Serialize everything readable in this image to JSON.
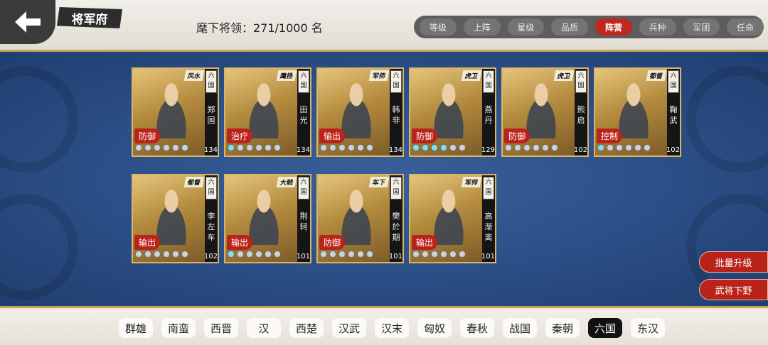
{
  "header": {
    "title": "将军府",
    "troop_count": "麾下将领：271/1000 名"
  },
  "sort_tabs": [
    {
      "label": "等级",
      "active": false
    },
    {
      "label": "上阵",
      "active": false
    },
    {
      "label": "星级",
      "active": false
    },
    {
      "label": "品质",
      "active": false
    },
    {
      "label": "阵营",
      "active": true
    },
    {
      "label": "兵种",
      "active": false
    },
    {
      "label": "军团",
      "active": false
    },
    {
      "label": "任命",
      "active": false
    }
  ],
  "generals": [
    {
      "name": "郑国",
      "title": "风水",
      "nation": "六国",
      "role": "防御",
      "level": "134",
      "stars_lit": 0
    },
    {
      "name": "田光",
      "title": "鹰扬",
      "nation": "六国",
      "role": "治疗",
      "level": "134",
      "stars_lit": 1
    },
    {
      "name": "韩非",
      "title": "军师",
      "nation": "六国",
      "role": "输出",
      "level": "134",
      "stars_lit": 0
    },
    {
      "name": "燕丹",
      "title": "虎卫",
      "nation": "六国",
      "role": "防御",
      "level": "129",
      "stars_lit": 4
    },
    {
      "name": "熊启",
      "title": "虎卫",
      "nation": "六国",
      "role": "防御",
      "level": "102",
      "stars_lit": 0
    },
    {
      "name": "鞠武",
      "title": "都督",
      "nation": "六国",
      "role": "控制",
      "level": "102",
      "stars_lit": 1
    },
    {
      "name": "李左车",
      "title": "都督",
      "nation": "六国",
      "role": "输出",
      "level": "102",
      "stars_lit": 0
    },
    {
      "name": "荆轲",
      "title": "大戟",
      "nation": "六国",
      "role": "输出",
      "level": "101",
      "stars_lit": 1
    },
    {
      "name": "樊於期",
      "title": "车下",
      "nation": "六国",
      "role": "防御",
      "level": "101",
      "stars_lit": 0
    },
    {
      "name": "高渐离",
      "title": "军师",
      "nation": "六国",
      "role": "输出",
      "level": "101",
      "stars_lit": 0
    }
  ],
  "actions": {
    "batch_upgrade": "批量升级",
    "release_general": "武将下野"
  },
  "factions": [
    {
      "label": "群雄",
      "active": false
    },
    {
      "label": "南蛮",
      "active": false
    },
    {
      "label": "西晋",
      "active": false
    },
    {
      "label": "汉",
      "active": false
    },
    {
      "label": "西楚",
      "active": false
    },
    {
      "label": "汉武",
      "active": false
    },
    {
      "label": "汉末",
      "active": false
    },
    {
      "label": "匈奴",
      "active": false
    },
    {
      "label": "春秋",
      "active": false
    },
    {
      "label": "战国",
      "active": false
    },
    {
      "label": "秦朝",
      "active": false
    },
    {
      "label": "六国",
      "active": true
    },
    {
      "label": "东汉",
      "active": false
    }
  ]
}
